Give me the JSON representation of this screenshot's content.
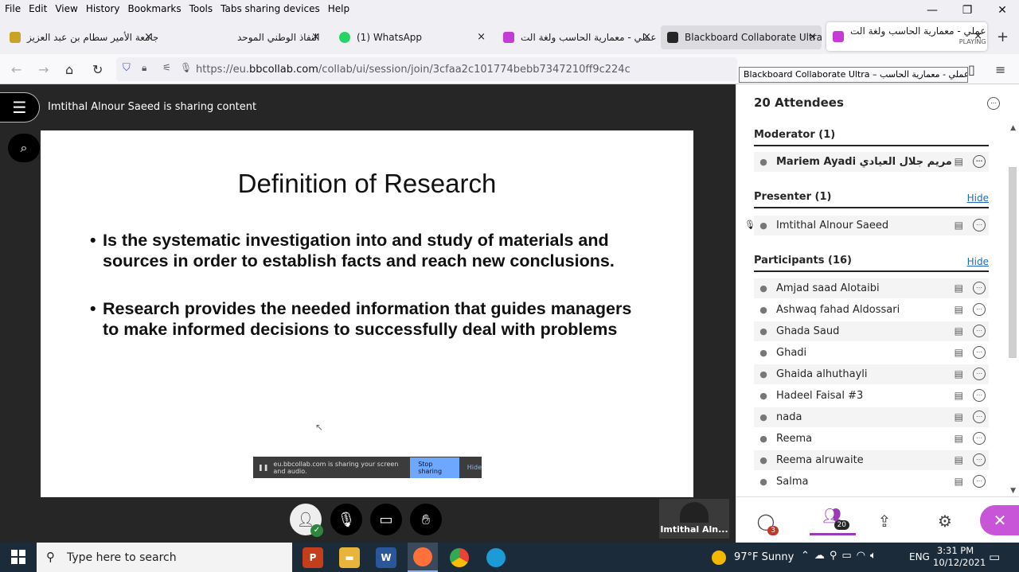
{
  "menubar": {
    "items": [
      "File",
      "Edit",
      "View",
      "History",
      "Bookmarks",
      "Tools",
      "Tabs sharing devices",
      "Help"
    ]
  },
  "tabs": [
    {
      "label": "جامعة الأمير سطام بن عبد العزيز",
      "color": "#c9a227"
    },
    {
      "label": "النفاذ الوطني الموحد"
    },
    {
      "label": "(1) WhatsApp",
      "color": "#25d366"
    },
    {
      "label": "عملي - معمارية الحاسب ولغة الت",
      "color": "#c43bd6"
    },
    {
      "label": "Blackboard Collaborate Ultra -",
      "color": "#262626"
    },
    {
      "label": "عملي - معمارية الحاسب ولغة الت",
      "sub": "PLAYING",
      "color": "#c43bd6"
    }
  ],
  "url": {
    "prefix": "https://eu.",
    "domain": "bbcollab.com",
    "path": "/collab/ui/session/join/3cfaa2c101774bebb7347210ff9c224c"
  },
  "tooltip": "Blackboard Collaborate Ultra – عملي - معمارية الحاسب ...",
  "session": {
    "sharing_message": "Imtithal Alnour Saeed is sharing content",
    "slide": {
      "title": "Definition of Research",
      "bullets": [
        "Is the systematic investigation into and study of materials and sources in order to establish facts and reach new conclusions.",
        "Research provides the needed information that guides managers to make informed decisions to successfully deal with problems"
      ]
    },
    "share_bar": {
      "text": "eu.bbcollab.com is sharing your screen and audio.",
      "stop": "Stop sharing",
      "hide": "Hide"
    },
    "video_tile": "Imtithal Aln..."
  },
  "panel": {
    "title": "20 Attendees",
    "moderator": {
      "header": "Moderator (1)",
      "people": [
        "Mariem Ayadi مريم جلال العيادي"
      ]
    },
    "presenter": {
      "header": "Presenter (1)",
      "hide": "Hide",
      "people": [
        "Imtithal Alnour Saeed"
      ]
    },
    "participants": {
      "header": "Participants (16)",
      "hide": "Hide",
      "people": [
        "Amjad saad Alotaibi",
        "Ashwaq fahad Aldossari",
        "Ghada Saud",
        "Ghadi",
        "Ghaida alhuthayli",
        "Hadeel Faisal #3",
        "nada",
        "Reema",
        "Reema alruwaite",
        "Salma"
      ]
    },
    "nav": {
      "chat_badge": "3",
      "people_badge": "20"
    }
  },
  "taskbar": {
    "search_placeholder": "Type here to search",
    "weather": "97°F  Sunny",
    "lang": "ENG",
    "time": "3:31 PM",
    "date": "10/12/2021"
  }
}
